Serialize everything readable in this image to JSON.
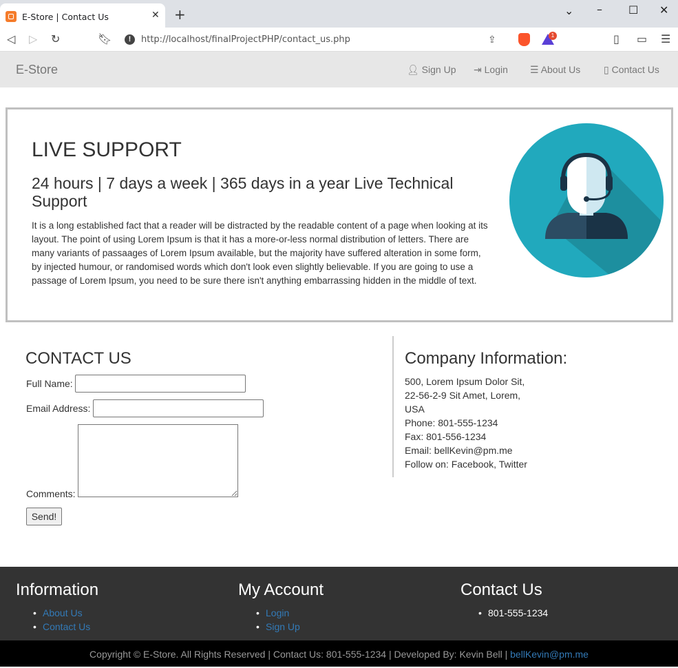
{
  "browser": {
    "tab_title": "E-Store | Contact Us",
    "url": "http://localhost/finalProjectPHP/contact_us.php",
    "brave_badge": "1"
  },
  "site_nav": {
    "brand": "E-Store",
    "items": [
      {
        "label": "Sign Up",
        "icon": "user-icon"
      },
      {
        "label": "Login",
        "icon": "login-icon"
      },
      {
        "label": "About Us",
        "icon": "list-icon"
      },
      {
        "label": "Contact Us",
        "icon": "phone-icon"
      }
    ]
  },
  "jumbotron": {
    "heading": "LIVE SUPPORT",
    "subheading": "24 hours | 7 days a week | 365 days in a year Live Technical Support",
    "body": "It is a long established fact that a reader will be distracted by the readable content of a page when looking at its layout. The point of using Lorem Ipsum is that it has a more-or-less normal distribution of letters. There are many variants of passaages of Lorem Ipsum available, but the majority have suffered alteration in some form, by injected humour, or randomised words which don't look even slightly believable. If you are going to use a passage of Lorem Ipsum, you need to be sure there isn't anything embarrassing hidden in the middle of text."
  },
  "contact_form": {
    "title": "CONTACT US",
    "full_name_label": "Full Name:",
    "email_label": "Email Address:",
    "comments_label": "Comments:",
    "full_name_value": "",
    "email_value": "",
    "comments_value": "",
    "send_label": "Send!"
  },
  "company_info": {
    "title": "Company Information:",
    "address_line1": "500, Lorem Ipsum Dolor Sit,",
    "address_line2": "22-56-2-9 Sit Amet, Lorem,",
    "address_line3": "USA",
    "phone": "Phone: 801-555-1234",
    "fax": "Fax: 801-556-1234",
    "email": "Email: bellKevin@pm.me",
    "follow": "Follow on: Facebook, Twitter"
  },
  "footer": {
    "information": {
      "title": "Information",
      "links": [
        "About Us",
        "Contact Us"
      ]
    },
    "my_account": {
      "title": "My Account",
      "links": [
        "Login",
        "Sign Up"
      ]
    },
    "contact_us": {
      "title": "Contact Us",
      "items": [
        "801-555-1234"
      ]
    },
    "copyright_text": "Copyright © E-Store. All Rights Reserved | Contact Us: 801-555-1234 | Developed By: Kevin Bell |",
    "copyright_email": "bellKevin@pm.me"
  },
  "colors": {
    "link": "#337ab7",
    "footer_bg": "#333333",
    "copyright_bg": "#000000",
    "support_circle": "#21a9bd"
  }
}
